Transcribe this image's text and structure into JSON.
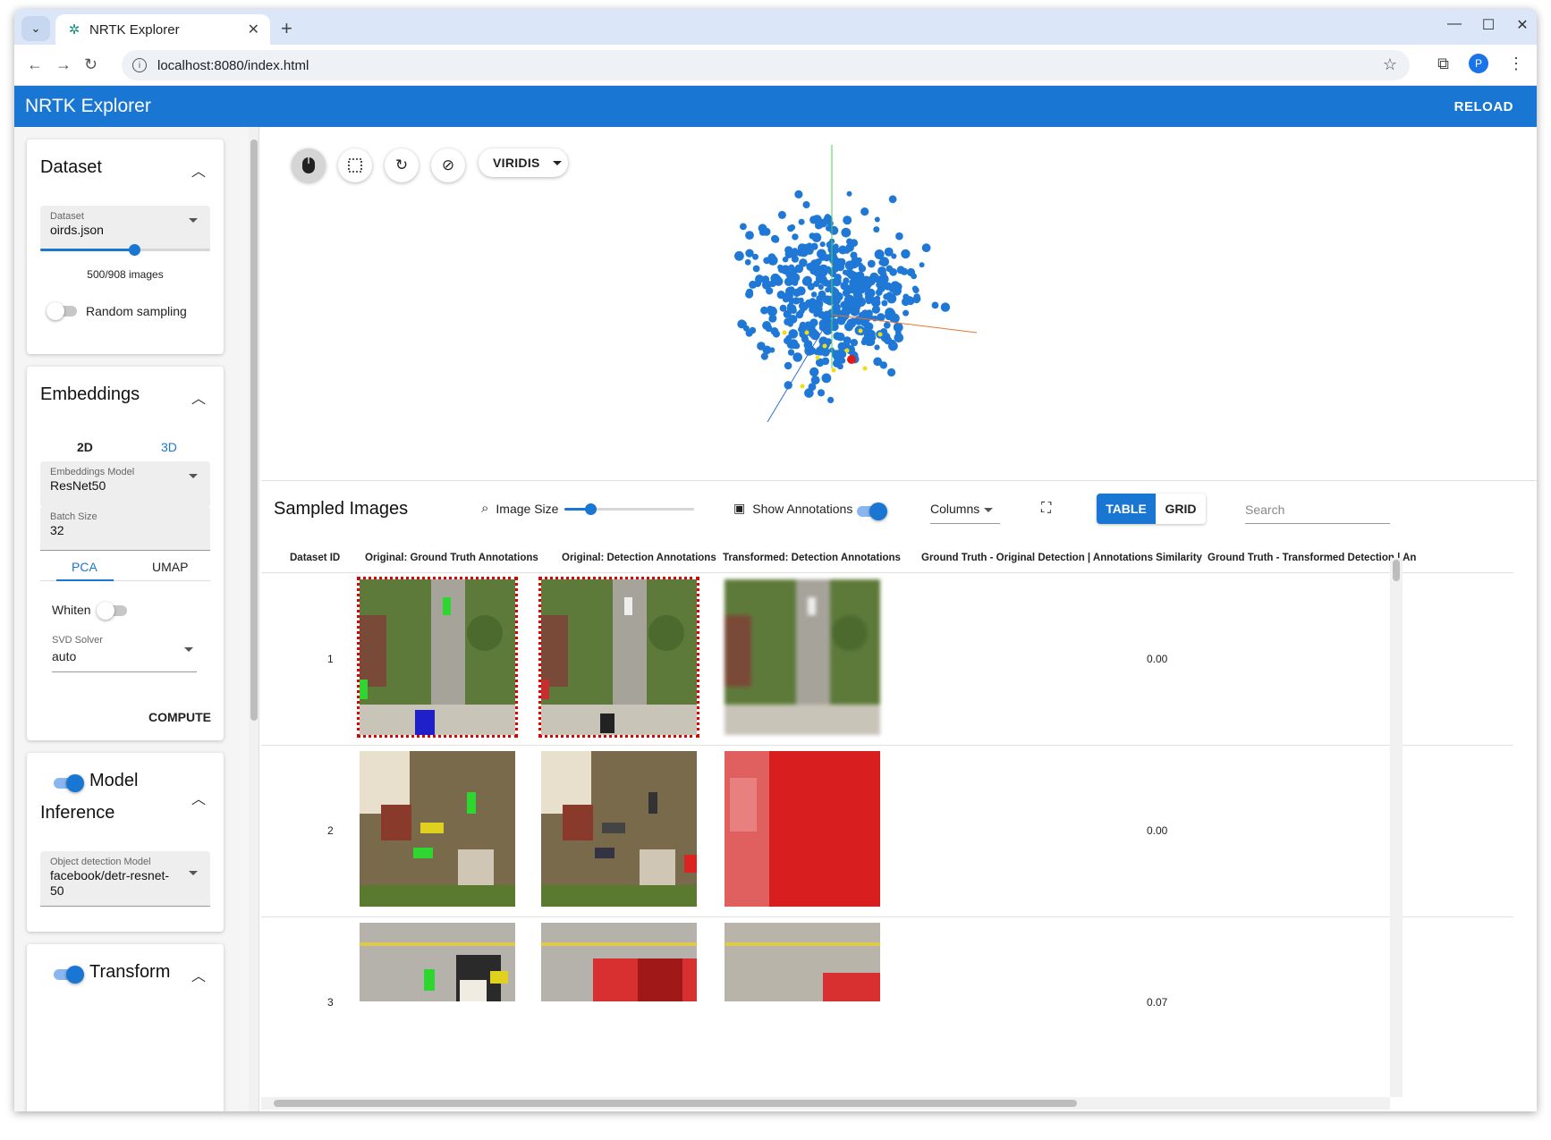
{
  "browser": {
    "tab_title": "NRTK Explorer",
    "url": "localhost:8080/index.html",
    "profile_initial": "P"
  },
  "app": {
    "title": "NRTK Explorer",
    "reload_label": "RELOAD",
    "accent_color": "#1976d2"
  },
  "dataset_card": {
    "title": "Dataset",
    "field_label": "Dataset",
    "field_value": "oirds.json",
    "slider_fraction": 0.55,
    "image_count_text": "500/908 images",
    "random_sampling_label": "Random sampling",
    "random_sampling_on": false
  },
  "embeddings_card": {
    "title": "Embeddings",
    "dim_tabs": [
      "2D",
      "3D"
    ],
    "model_label": "Embeddings Model",
    "model_value": "ResNet50",
    "batch_label": "Batch Size",
    "batch_value": "32",
    "method_tabs": [
      "PCA",
      "UMAP"
    ],
    "whiten_label": "Whiten",
    "solver_label": "SVD Solver",
    "solver_value": "auto",
    "compute_label": "COMPUTE"
  },
  "inference_card": {
    "title_line1": "Model",
    "title_line2": "Inference",
    "model_label": "Object detection Model",
    "model_value": "facebook/detr-resnet-50",
    "enabled": true
  },
  "transform_card": {
    "title": "Transform",
    "enabled": true
  },
  "viewer": {
    "colormap_label": "VIRIDIS",
    "tools": [
      "mouse-icon",
      "box-select-icon",
      "refresh-icon",
      "clear-selection-icon"
    ]
  },
  "sampled": {
    "title": "Sampled Images",
    "image_size_label": "Image Size",
    "image_size_fraction": 0.2,
    "show_annotations_label": "Show Annotations",
    "columns_label": "Columns",
    "table_label": "TABLE",
    "grid_label": "GRID",
    "search_placeholder": "Search",
    "headers": [
      "Dataset ID",
      "Original: Ground Truth Annotations",
      "Original: Detection Annotations",
      "Transformed: Detection Annotations",
      "Ground Truth - Original Detection | Annotations Similarity",
      "Ground Truth - Transformed Detection | An"
    ],
    "rows": [
      {
        "id": "1",
        "similarity": "0.00"
      },
      {
        "id": "2",
        "similarity": "0.00"
      },
      {
        "id": "3",
        "similarity": "0.07"
      }
    ]
  }
}
